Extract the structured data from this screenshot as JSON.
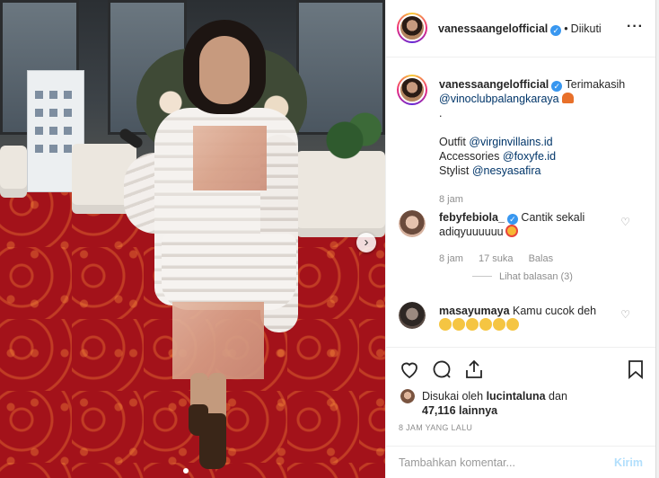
{
  "post": {
    "author": "vanessaangelofficial",
    "follow_state": "Diikuti",
    "separator": "•",
    "more_symbol": "···"
  },
  "caption": {
    "author": "vanessaangelofficial",
    "text_intro": "Terimakasih",
    "mention": "@vinoclubpalangkaraya",
    "dot": ".",
    "outfit_label": "Outfit",
    "outfit_mention": "@virginvillains.id",
    "accessories_label": "Accessories",
    "accessories_mention": "@foxyfe.id",
    "stylist_label": "Stylist",
    "stylist_mention": "@nesyasafira",
    "time": "8 jam"
  },
  "comments": [
    {
      "author": "febyfebiola_",
      "text": "Cantik sekali adiqyuuuuuu",
      "time": "8 jam",
      "likes": "17 suka",
      "reply": "Balas",
      "view_replies": "Lihat balasan (3)"
    },
    {
      "author": "masayumaya",
      "text": "Kamu cucok deh"
    }
  ],
  "likes": {
    "prefix": "Disukai oleh",
    "user": "lucintaluna",
    "joiner": "dan",
    "count": "47,116",
    "suffix": "lainnya"
  },
  "timestamp": "8 JAM YANG LALU",
  "add_comment": {
    "placeholder": "Tambahkan komentar...",
    "post_label": "Kirim"
  },
  "colors": {
    "verified": "#3897f0",
    "link": "#003569",
    "muted": "#8e8e8e",
    "post_disabled": "#b2dffc"
  },
  "icons": {
    "like": "heart-icon",
    "comment": "comment-icon",
    "share": "share-icon",
    "save": "bookmark-icon",
    "more": "more-icon",
    "next": "chevron-right-icon"
  }
}
